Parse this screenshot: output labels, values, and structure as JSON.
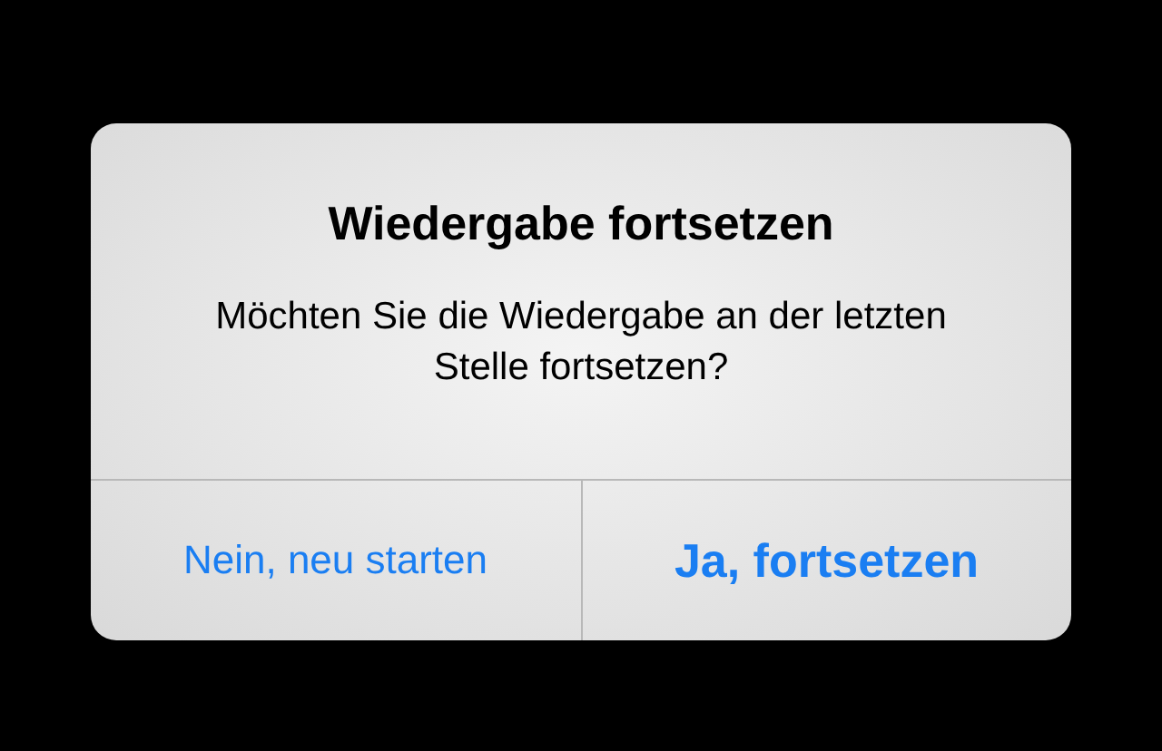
{
  "alert": {
    "title": "Wiedergabe fortsetzen",
    "message": "Möchten Sie die Wiedergabe an der letzten Stelle fortsetzen?",
    "buttons": [
      {
        "label": "Nein, neu starten",
        "kind": "cancel"
      },
      {
        "label": "Ja, fortsetzen",
        "kind": "preferred"
      }
    ]
  }
}
